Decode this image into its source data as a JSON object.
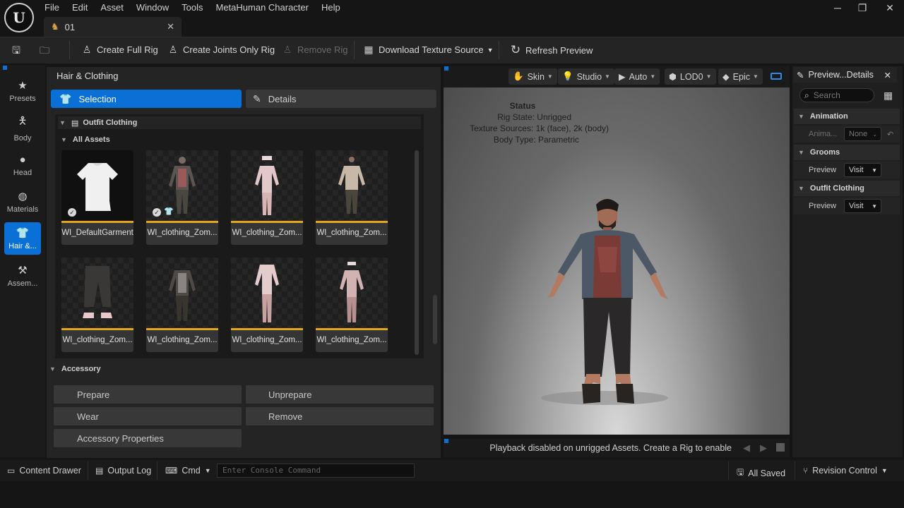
{
  "menu": [
    "File",
    "Edit",
    "Asset",
    "Window",
    "Tools",
    "MetaHuman Character",
    "Help"
  ],
  "tab": {
    "title": "01"
  },
  "toolbar": {
    "create_full_rig": "Create Full Rig",
    "create_joints_only_rig": "Create Joints Only Rig",
    "remove_rig": "Remove Rig",
    "download_texture_source": "Download Texture Source",
    "refresh_preview": "Refresh Preview"
  },
  "sidebar": {
    "items": [
      {
        "label": "Presets",
        "icon": "star-icon"
      },
      {
        "label": "Body",
        "icon": "person-icon"
      },
      {
        "label": "Head",
        "icon": "head-icon"
      },
      {
        "label": "Materials",
        "icon": "materials-icon"
      },
      {
        "label": "Hair &...",
        "icon": "hair-clothing-icon",
        "active": true
      },
      {
        "label": "Assem...",
        "icon": "hammer-icon"
      }
    ]
  },
  "panel": {
    "title": "Hair & Clothing",
    "selection": "Selection",
    "details": "Details",
    "outfit_clothing": "Outfit Clothing",
    "all_assets": "All Assets",
    "assets": [
      "WI_DefaultGarment",
      "WI_clothing_Zom...",
      "WI_clothing_Zom...",
      "WI_clothing_Zom...",
      "WI_clothing_Zom...",
      "WI_clothing_Zom...",
      "WI_clothing_Zom...",
      "WI_clothing_Zom..."
    ],
    "accessory": "Accessory",
    "buttons": {
      "prepare": "Prepare",
      "unprepare": "Unprepare",
      "wear": "Wear",
      "remove": "Remove",
      "properties": "Accessory Properties"
    }
  },
  "viewport": {
    "toolbar": {
      "skin": "Skin",
      "studio": "Studio",
      "auto": "Auto",
      "lod": "LOD0",
      "quality": "Epic"
    },
    "status": {
      "heading": "Status",
      "rig_state": "Rig State: Unrigged",
      "texture_sources": "Texture Sources: 1k (face), 2k (body)",
      "body_type": "Body Type: Parametric"
    },
    "playback": "Playback disabled on unrigged Assets. Create a Rig to enable"
  },
  "details_panel": {
    "tab": "Preview...Details",
    "search_placeholder": "Search",
    "animation": "Animation",
    "anim_label": "Anima...",
    "anim_value": "None",
    "grooms": "Grooms",
    "groom_preview": "Preview",
    "groom_value": "Visit",
    "outfit": "Outfit Clothing",
    "outfit_preview": "Preview",
    "outfit_value": "Visit"
  },
  "statusbar": {
    "content_drawer": "Content Drawer",
    "output_log": "Output Log",
    "cmd": "Cmd",
    "console_placeholder": "Enter Console Command",
    "all_saved": "All Saved",
    "revision_control": "Revision Control"
  },
  "colors": {
    "accent": "#0a70d6",
    "asset_bar": "#e3a51b"
  }
}
